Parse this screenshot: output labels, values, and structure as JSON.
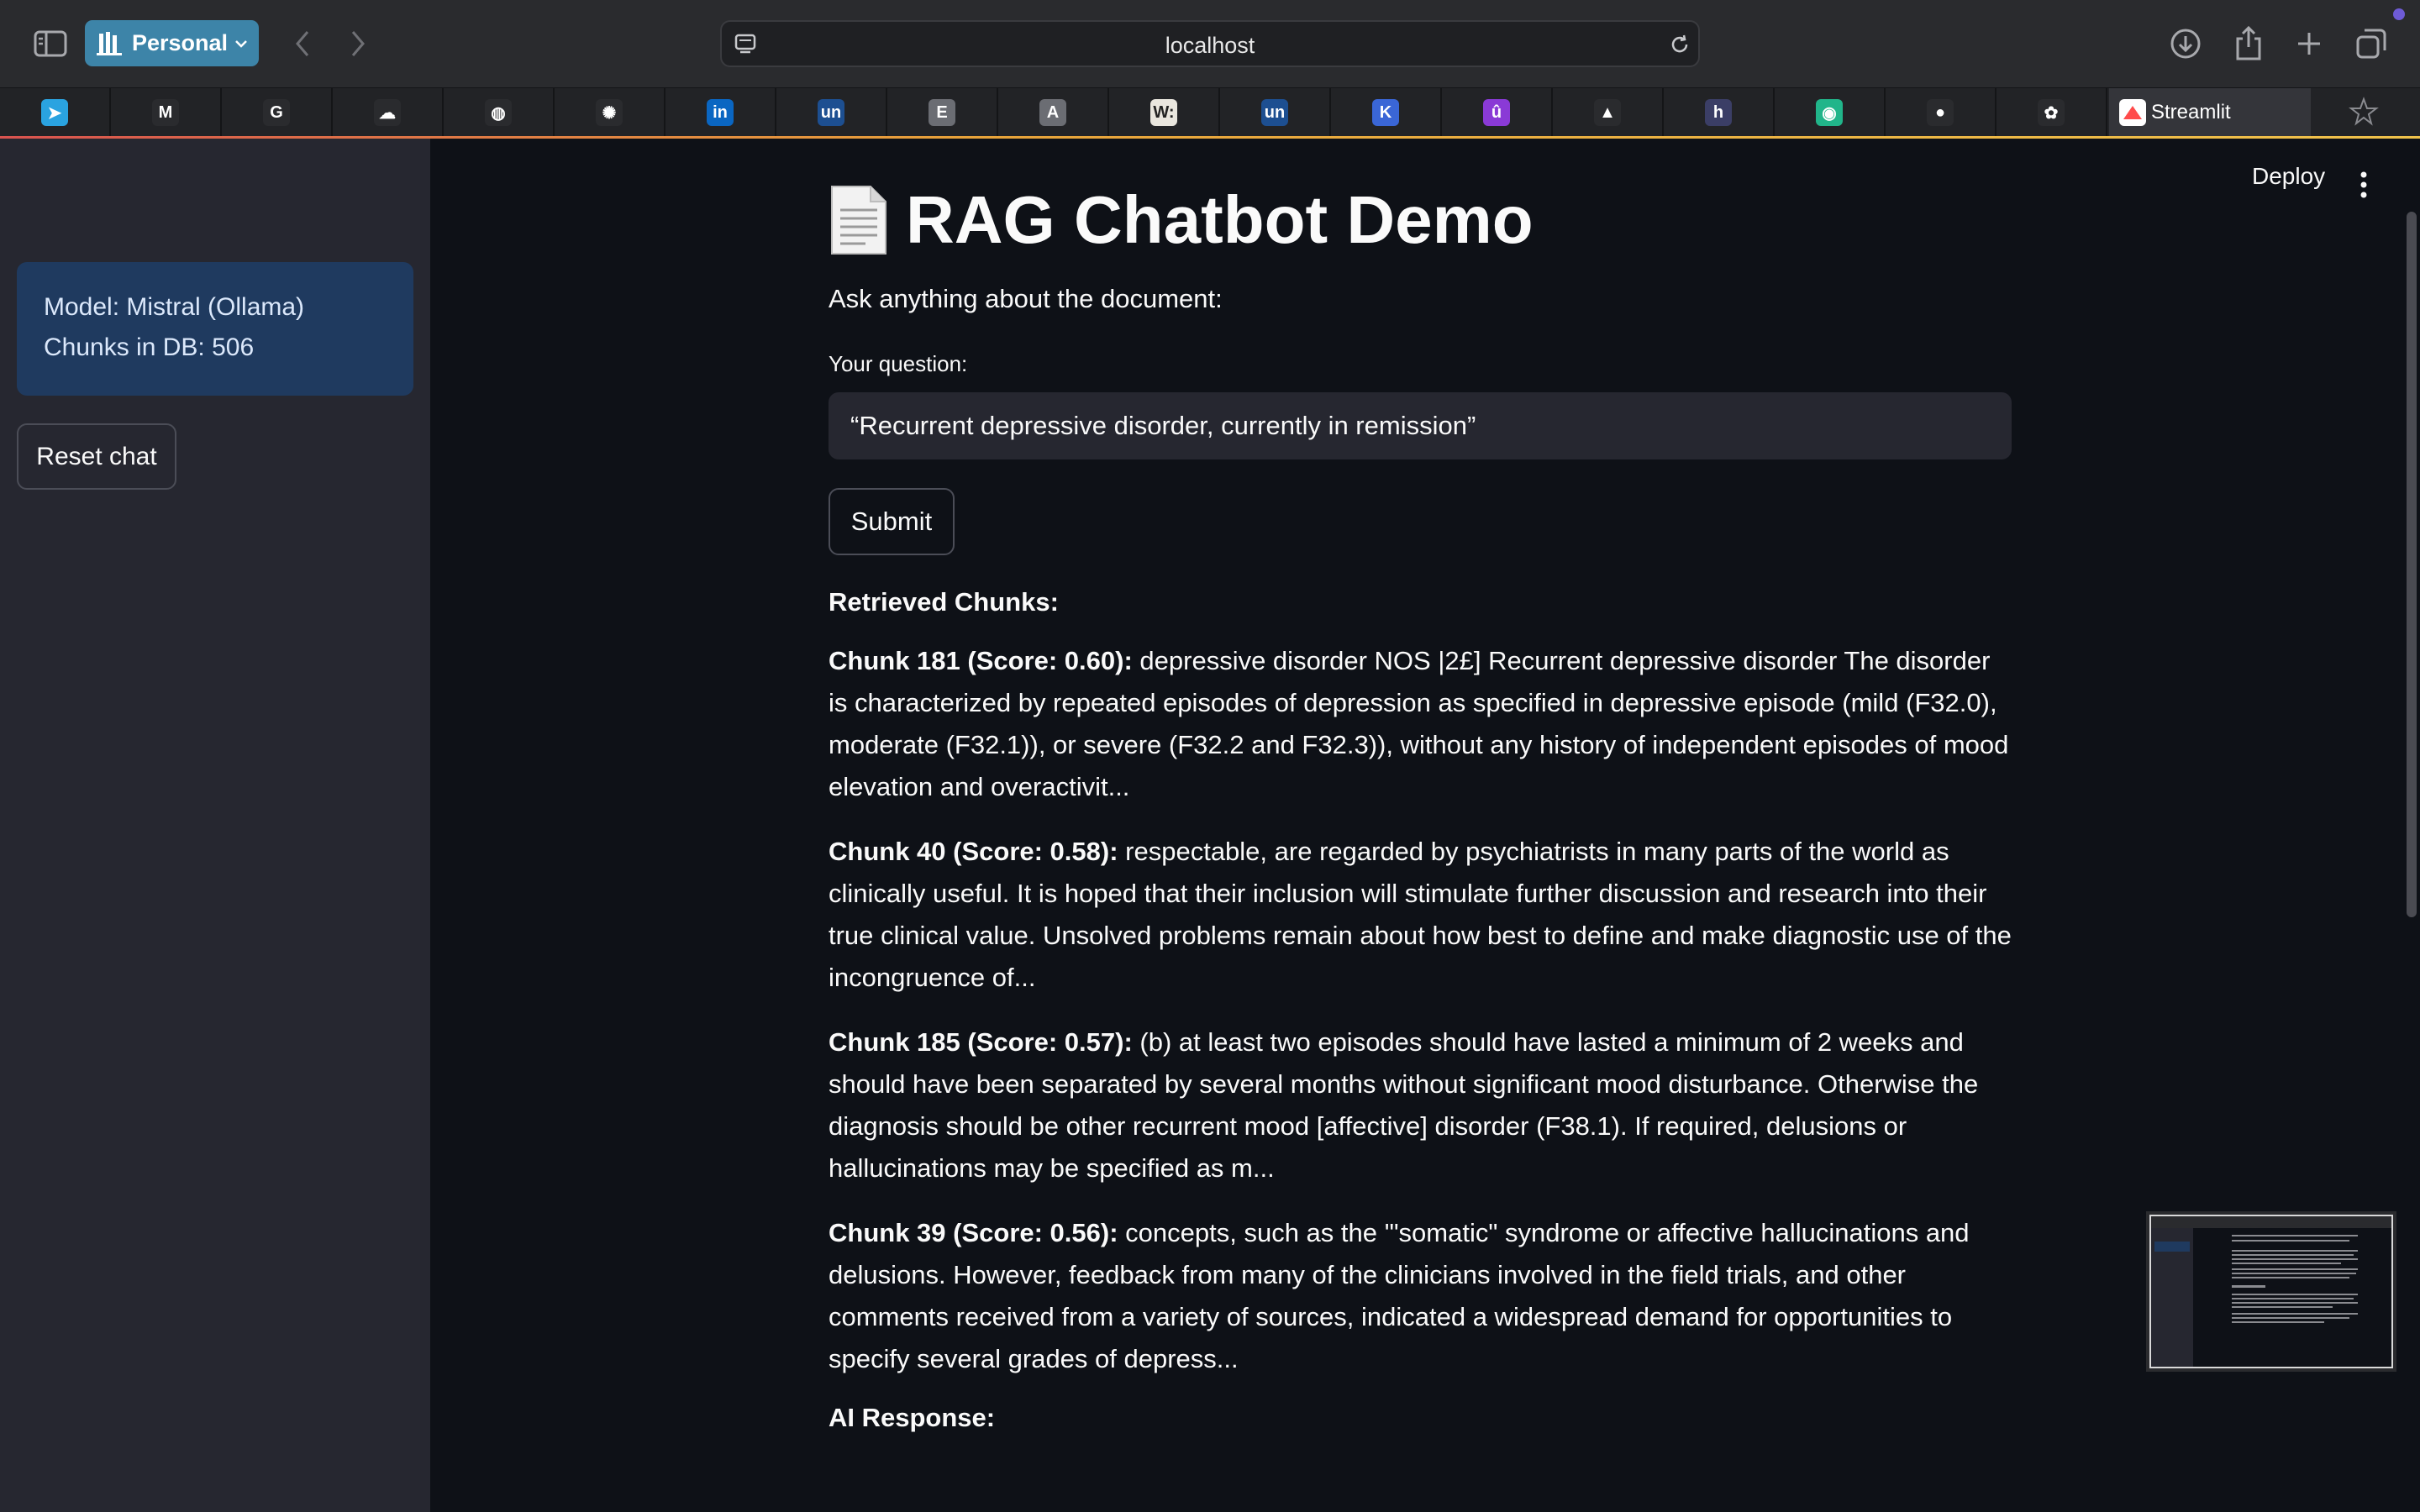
{
  "browser": {
    "profile_label": "Personal",
    "url": "localhost",
    "pinned_tabs": [
      {
        "name": "telegram",
        "glyph": "➤",
        "color": "#2aa3e0"
      },
      {
        "name": "gmail",
        "glyph": "M",
        "color": "#2a2b2e"
      },
      {
        "name": "google",
        "glyph": "G",
        "color": "#2a2b2e"
      },
      {
        "name": "cloud",
        "glyph": "☁",
        "color": "#2a2b2e"
      },
      {
        "name": "globe",
        "glyph": "◍",
        "color": "#2a2b2e"
      },
      {
        "name": "chatgpt",
        "glyph": "✺",
        "color": "#2a2b2e"
      },
      {
        "name": "linkedin",
        "glyph": "in",
        "color": "#0a66c2"
      },
      {
        "name": "un",
        "glyph": "un",
        "color": "#1d4f91"
      },
      {
        "name": "e",
        "glyph": "E",
        "color": "#6b6d73"
      },
      {
        "name": "a",
        "glyph": "A",
        "color": "#6b6d73"
      },
      {
        "name": "w",
        "glyph": "W:",
        "color": "#e9e6de"
      },
      {
        "name": "un-2",
        "glyph": "un",
        "color": "#1d4f91"
      },
      {
        "name": "k",
        "glyph": "K",
        "color": "#3a66d6"
      },
      {
        "name": "u",
        "glyph": "û",
        "color": "#8a3ad6"
      },
      {
        "name": "drive",
        "glyph": "▲",
        "color": "#2a2b2e"
      },
      {
        "name": "h",
        "glyph": "h",
        "color": "#3b3e66"
      },
      {
        "name": "chat",
        "glyph": "◉",
        "color": "#21b58a"
      },
      {
        "name": "github",
        "glyph": "●",
        "color": "#2a2b2e"
      },
      {
        "name": "photos",
        "glyph": "✿",
        "color": "#2a2b2e"
      }
    ],
    "active_tab_label": "Streamlit"
  },
  "sidebar": {
    "model_line": "Model: Mistral (Ollama)",
    "chunks_line": "Chunks in DB: 506",
    "reset_label": "Reset chat"
  },
  "header": {
    "deploy_label": "Deploy"
  },
  "main": {
    "title": "RAG Chatbot Demo",
    "subtitle": "Ask anything about the document:",
    "question_label": "Your question:",
    "question_value": "“Recurrent depressive disorder, currently in remission”",
    "submit_label": "Submit",
    "retrieved_heading": "Retrieved Chunks:",
    "chunks": [
      {
        "label": "Chunk 181 (Score: 0.60):",
        "text": " depressive disorder NOS |2£] Recurrent depressive disorder The disorder is characterized by repeated episodes of depression as specified in depressive episode (mild (F32.0), moderate (F32.1)), or severe (F32.2 and F32.3)), without any history of independent episodes of mood elevation and overactivit..."
      },
      {
        "label": "Chunk 40 (Score: 0.58):",
        "text": " respectable, are regarded by psychiatrists in many parts of the world as clinically useful. It is hoped that their inclusion will stimulate further discussion and research into their true clinical value. Unsolved problems remain about how best to define and make diagnostic use of the incongruence of..."
      },
      {
        "label": "Chunk 185 (Score: 0.57):",
        "text": " (b) at least two episodes should have lasted a minimum of 2 weeks and should have been separated by several months without significant mood disturbance. Otherwise the diagnosis should be other recurrent mood [affective] disorder (F38.1). If required, delusions or hallucinations may be specified as m..."
      },
      {
        "label": "Chunk 39 (Score: 0.56):",
        "text": " concepts, such as the '\"somatic\" syndrome or affective hallucinations and delusions. However, feedback from many of the clinicians involved in the field trials, and other comments received from a variety of sources, indicated a widespread demand for opportunities to specify several grades of depress..."
      }
    ],
    "ai_heading": "AI Response:"
  }
}
